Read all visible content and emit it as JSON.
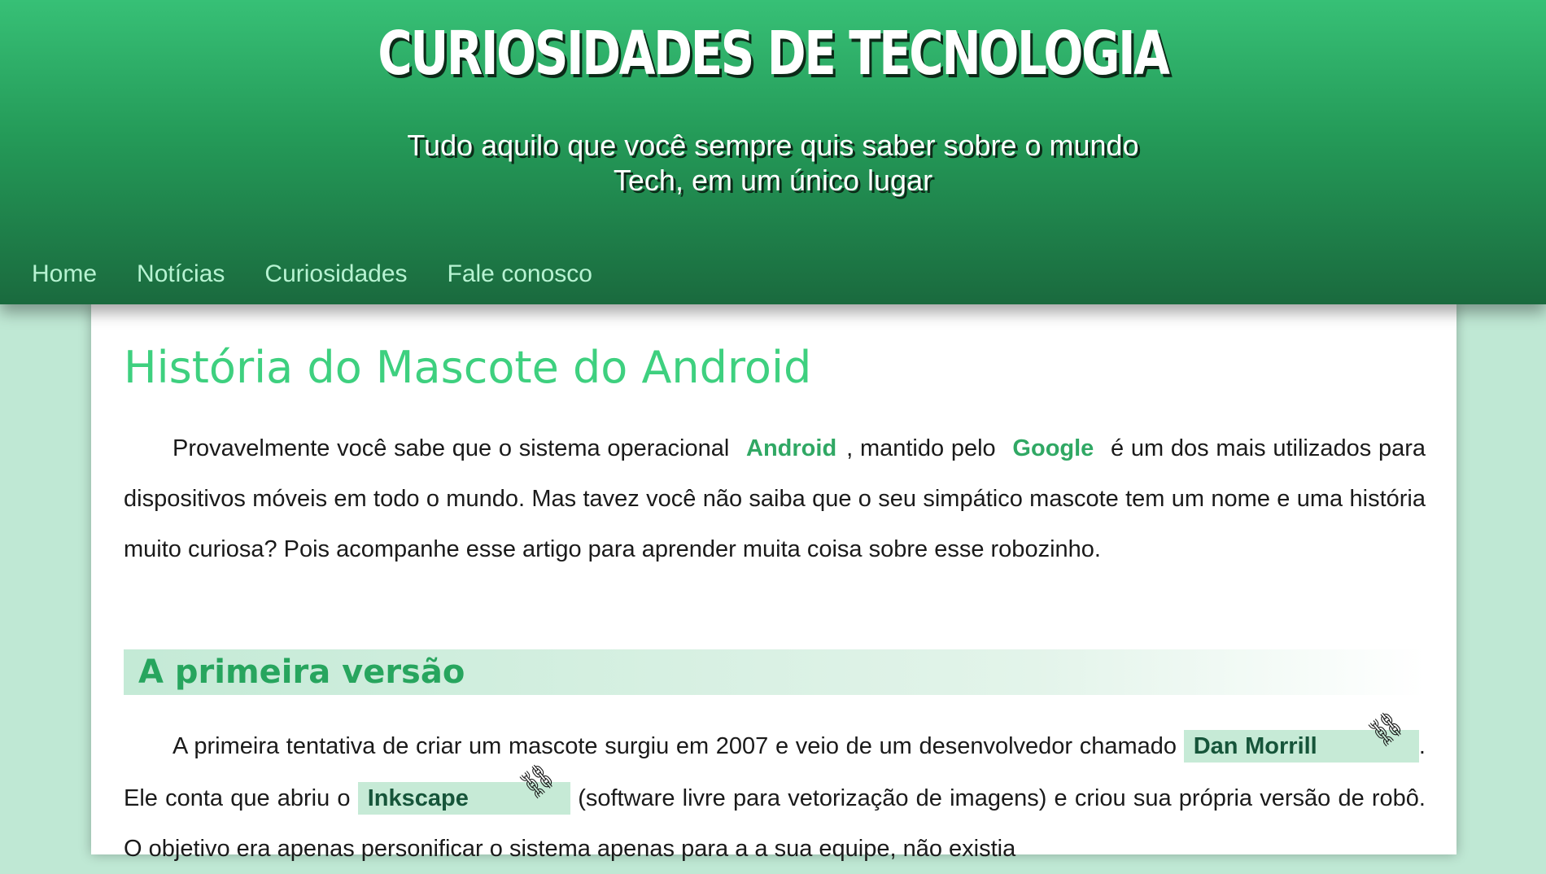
{
  "header": {
    "title": "CURIOSIDADES DE TECNOLOGIA",
    "subtitle_line1": "Tudo aquilo que você sempre quis saber sobre o mundo",
    "subtitle_line2": "Tech, em um único lugar"
  },
  "nav": {
    "items": [
      "Home",
      "Notícias",
      "Curiosidades",
      "Fale conosco"
    ]
  },
  "article": {
    "title": "História do Mascote do Android",
    "p1": {
      "t1": "Provavelmente você sabe que o sistema operacional",
      "android": "Android",
      "t2": ", mantido pelo",
      "google": "Google",
      "t3": "é um dos mais utilizados para dispositivos móveis em todo o mundo. Mas tavez você não saiba que o seu simpático mascote tem um nome e uma história muito curiosa? Pois acompanhe esse artigo para aprender muita coisa sobre esse robozinho."
    },
    "section1_heading": "A primeira versão",
    "p2": {
      "t1": "A primeira tentativa de criar um mascote surgiu em 2007 e veio de um desenvolvedor chamado",
      "dan_morrill": "Dan Morrill",
      "t2": ". Ele conta que abriu o",
      "inkscape": "Inkscape",
      "t3": "(software livre para vetorização de imagens) e criou sua própria versão de robô. O objetivo era apenas personificar o sistema apenas para a a sua equipe, não existia"
    },
    "link_icon_glyph": "⛓"
  },
  "colors": {
    "header_top": "#37c076",
    "header_bottom": "#1a6a3e",
    "page_background": "#bfe8d4",
    "title_green": "#3ed07f",
    "nav_link": "#b7f3d2",
    "highlight_box": "#c6ead6"
  }
}
